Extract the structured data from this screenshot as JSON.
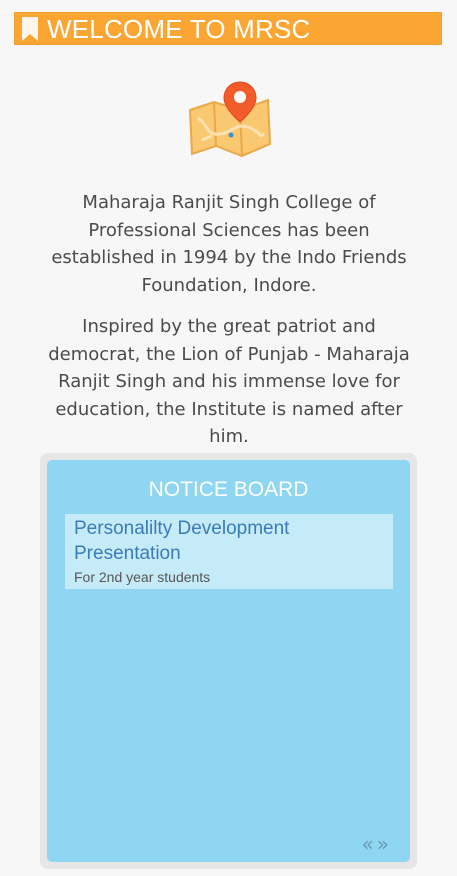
{
  "header": {
    "title": "WELCOME TO MRSC",
    "icon": "bookmark-icon",
    "bg_color": "#fba633"
  },
  "intro": {
    "icon": "map-pin-icon",
    "paragraph1": "Maharaja Ranjit Singh College of Professional Sciences has been established in 1994 by the Indo Friends Foundation, Indore.",
    "paragraph2": "Inspired by the great patriot and democrat, the Lion of Punjab - Maharaja Ranjit Singh and his immense love for education, the Institute is named after him."
  },
  "notice_board": {
    "title": "NOTICE BOARD",
    "bg_color": "#8ed6f2",
    "items": [
      {
        "title": "Personalilty Development Presentation",
        "subtitle": "For 2nd year students"
      }
    ],
    "pager": {
      "prev": "«",
      "next": "»"
    }
  }
}
